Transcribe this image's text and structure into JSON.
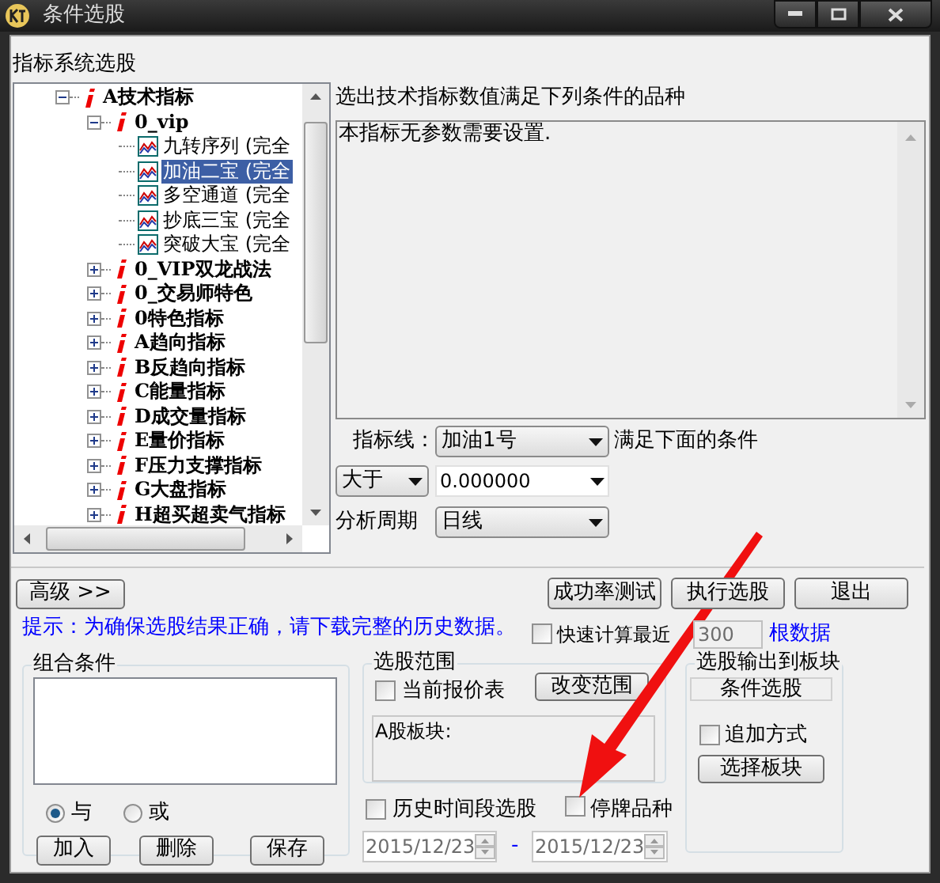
{
  "window": {
    "title": "条件选股"
  },
  "tree": {
    "label": "指标系统选股",
    "items": [
      {
        "label": "A技术指标",
        "kind": "group",
        "expanded": true,
        "selected": false,
        "children": [
          {
            "label": "0_vip",
            "kind": "group",
            "expanded": true,
            "selected": false,
            "children": [
              {
                "label": "九转序列 (完全",
                "kind": "indicator",
                "selected": false
              },
              {
                "label": "加油二宝 (完全",
                "kind": "indicator",
                "selected": true
              },
              {
                "label": "多空通道 (完全",
                "kind": "indicator",
                "selected": false
              },
              {
                "label": "抄底三宝 (完全",
                "kind": "indicator",
                "selected": false
              },
              {
                "label": "突破大宝 (完全",
                "kind": "indicator",
                "selected": false
              }
            ]
          },
          {
            "label": "0_VIP双龙战法",
            "kind": "group",
            "expanded": false,
            "selected": false
          },
          {
            "label": "0_交易师特色",
            "kind": "group",
            "expanded": false,
            "selected": false
          },
          {
            "label": "0特色指标",
            "kind": "group",
            "expanded": false,
            "selected": false
          },
          {
            "label": "A趋向指标",
            "kind": "group",
            "expanded": false,
            "selected": false
          },
          {
            "label": "B反趋向指标",
            "kind": "group",
            "expanded": false,
            "selected": false
          },
          {
            "label": "C能量指标",
            "kind": "group",
            "expanded": false,
            "selected": false
          },
          {
            "label": "D成交量指标",
            "kind": "group",
            "expanded": false,
            "selected": false
          },
          {
            "label": "E量价指标",
            "kind": "group",
            "expanded": false,
            "selected": false
          },
          {
            "label": "F压力支撑指标",
            "kind": "group",
            "expanded": false,
            "selected": false
          },
          {
            "label": "G大盘指标",
            "kind": "group",
            "expanded": false,
            "selected": false
          },
          {
            "label": "H超买超卖气指标",
            "kind": "group",
            "expanded": false,
            "selected": false
          }
        ]
      }
    ]
  },
  "condition": {
    "heading": "选出技术指标数值满足下列条件的品种",
    "description": "本指标无参数需要设置.",
    "line_label": "指标线：",
    "line_value": "加油1号",
    "line_suffix": "满足下面的条件",
    "operator": "大于",
    "threshold": "0.000000",
    "period_label": "分析周期",
    "period": "日线"
  },
  "buttons": {
    "advanced": "高级 >>",
    "test": "成功率测试",
    "execute": "执行选股",
    "exit": "退出"
  },
  "hint": "提示：为确保选股结果正确，请下载完整的历史数据。",
  "quick": {
    "label": "快速计算最近",
    "checked": false,
    "value": "300",
    "suffix": "根数据"
  },
  "combo": {
    "title": "组合条件",
    "radios": [
      {
        "label": "与",
        "selected": true
      },
      {
        "label": "或",
        "selected": false
      }
    ],
    "buttons": [
      "加入",
      "删除",
      "保存"
    ]
  },
  "range": {
    "title": "选股范围",
    "current_label": "当前报价表",
    "current_checked": false,
    "change_button": "改变范围",
    "scope": "A股板块:"
  },
  "history": {
    "label": "历史时间段选股",
    "checked": false,
    "suspended_label": "停牌品种",
    "suspended_checked": false,
    "start": "2015/12/23",
    "separator": "-",
    "end": "2015/12/23"
  },
  "output": {
    "title": "选股输出到板块",
    "block": "条件选股",
    "append_label": "追加方式",
    "append_checked": false,
    "button": "选择板块"
  }
}
